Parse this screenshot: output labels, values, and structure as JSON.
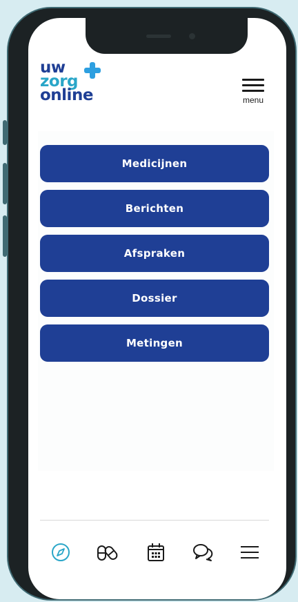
{
  "logo": {
    "line1": "uw",
    "line2": "zorg",
    "line3": "online",
    "color_line1": "#1f3f95",
    "color_line2": "#2aa6c8",
    "color_line3": "#1f3f95",
    "cross_color": "#2d9fe0"
  },
  "header": {
    "menu_label": "menu"
  },
  "main": {
    "buttons": [
      {
        "label": "Medicijnen"
      },
      {
        "label": "Berichten"
      },
      {
        "label": "Afspraken"
      },
      {
        "label": "Dossier"
      },
      {
        "label": "Metingen"
      }
    ]
  },
  "bottom_nav": {
    "items": [
      {
        "icon": "compass-icon",
        "active": true
      },
      {
        "icon": "pills-icon",
        "active": false
      },
      {
        "icon": "calendar-icon",
        "active": false
      },
      {
        "icon": "chat-icon",
        "active": false
      },
      {
        "icon": "menu-icon",
        "active": false
      }
    ]
  },
  "colors": {
    "primary": "#1f3f95",
    "accent": "#2aa6c8",
    "background": "#d7ecf1"
  }
}
